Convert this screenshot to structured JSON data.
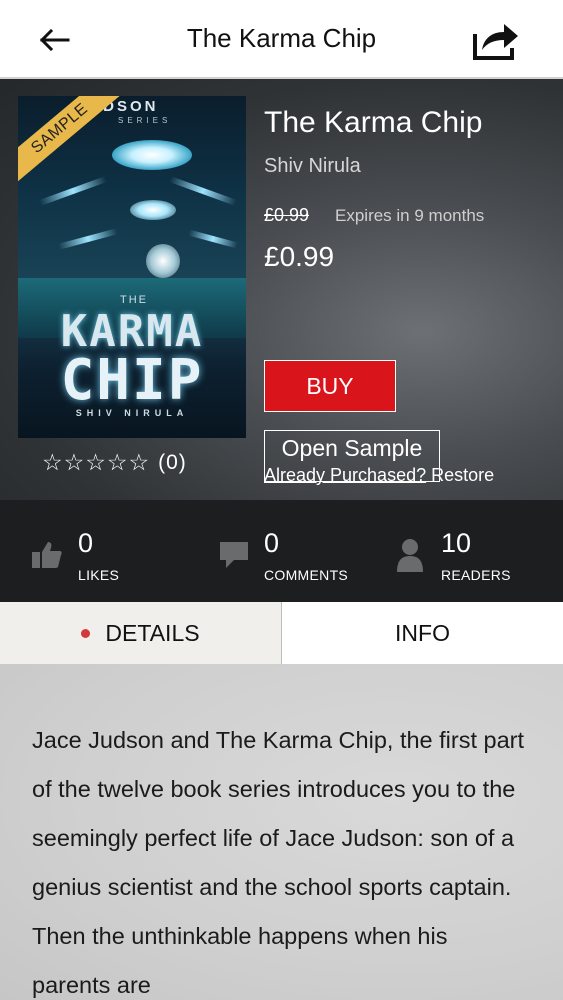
{
  "header": {
    "title": "The Karma Chip",
    "back_icon": "arrow-left-icon",
    "share_icon": "share-icon"
  },
  "cover": {
    "ribbon": "SAMPLE",
    "series_text": "JUDSON",
    "series_sub": "SERIES",
    "the": "THE",
    "word1": "KARMA",
    "word2": "CHIP",
    "author": "SHIV NIRULA"
  },
  "rating": {
    "stars": "☆☆☆☆☆",
    "count": "(0)"
  },
  "book": {
    "title": "The Karma Chip",
    "author": "Shiv Nirula",
    "old_price": "£0.99",
    "expires": "Expires in 9 months",
    "price": "£0.99"
  },
  "actions": {
    "buy": "BUY",
    "open_sample": "Open Sample",
    "already_purchased": "Already Purchased?",
    "restore": " Restore"
  },
  "stats": [
    {
      "value": "0",
      "label": "LIKES",
      "icon": "thumbs-up-icon"
    },
    {
      "value": "0",
      "label": "COMMENTS",
      "icon": "comment-icon"
    },
    {
      "value": "10",
      "label": "READERS",
      "icon": "person-icon"
    }
  ],
  "tabs": {
    "details": "DETAILS",
    "info": "INFO"
  },
  "description": "Jace Judson and The Karma Chip, the first part of the twelve book series introduces you to the seemingly perfect life of Jace Judson: son of a genius scientist and the school sports captain. Then the unthinkable happens when his parents are",
  "colors": {
    "buy": "#d9141b",
    "active_dot": "#d23a3a",
    "stats_bg": "#1d1e20"
  }
}
